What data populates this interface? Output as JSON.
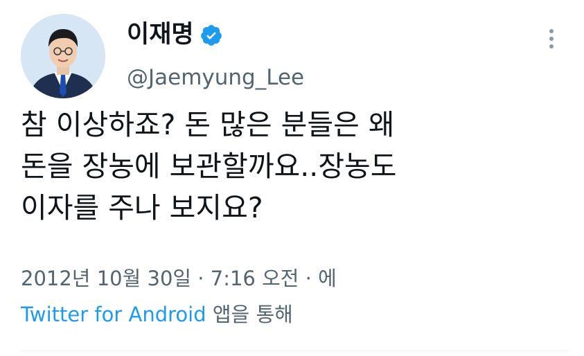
{
  "tweet": {
    "author": {
      "display_name": "이재명",
      "handle": "@Jaemyung_Lee",
      "verified_icon": "verified-badge-icon",
      "verified_color": "#1d9bf0"
    },
    "more_icon": "more-options-icon",
    "text_lines": [
      "참 이상하죠? 돈 많은 분들은 왜",
      "돈을 장농에 보관할까요..장농도",
      "이자를 주나 보지요?"
    ],
    "meta": {
      "timestamp": "2012년 10월 30일 · 7:16 오전 · 에",
      "source": "Twitter for Android",
      "source_suffix": "앱을 통해"
    },
    "colors": {
      "text": "#0f1419",
      "secondary": "#536471",
      "link": "#1d9bf0"
    }
  }
}
